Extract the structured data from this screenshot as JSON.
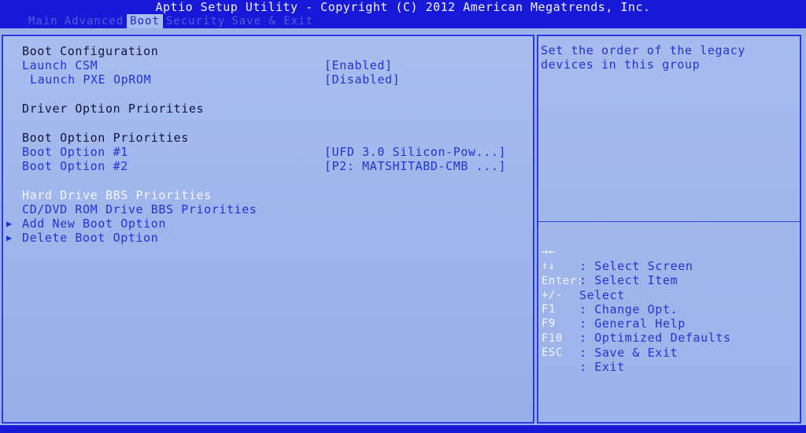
{
  "header": {
    "title": "Aptio Setup Utility - Copyright (C) 2012 American Megatrends, Inc.",
    "tabs": [
      {
        "label": "Main",
        "active": false
      },
      {
        "label": "Advanced",
        "active": false
      },
      {
        "label": "Boot",
        "active": true
      },
      {
        "label": "Security",
        "active": false
      },
      {
        "label": "Save & Exit",
        "active": false
      }
    ]
  },
  "boot": {
    "section_boot_config": "Boot Configuration",
    "launch_csm": {
      "label": "Launch CSM",
      "value": "[Enabled]"
    },
    "launch_pxe": {
      "label": "Launch PXE OpROM",
      "value": "[Disabled]"
    },
    "section_driver": "Driver Option Priorities",
    "section_boot_option": "Boot Option Priorities",
    "boot_option_1": {
      "label": "Boot Option #1",
      "value": "[UFD 3.0 Silicon-Pow...]"
    },
    "boot_option_2": {
      "label": "Boot Option #2",
      "value": "[P2: MATSHITABD-CMB ...]"
    },
    "hdd_bbs": "Hard Drive BBS Priorities",
    "cd_bbs": "CD/DVD ROM Drive BBS Priorities",
    "add_boot": "Add New Boot Option",
    "delete_boot": "Delete Boot Option",
    "submenu_arrow": "▶"
  },
  "help": {
    "line1": "Set the order of the legacy",
    "line2": "devices in this group"
  },
  "keys": [
    {
      "key": "→←",
      "desc": ": Select Screen"
    },
    {
      "key": "↑↓",
      "desc": ": Select Item"
    },
    {
      "key": "Enter:",
      "desc": "Select"
    },
    {
      "key": "+/-",
      "desc": ": Change Opt."
    },
    {
      "key": "F1",
      "desc": ": General Help"
    },
    {
      "key": "F9",
      "desc": ": Optimized Defaults"
    },
    {
      "key": "F10",
      "desc": ": Save & Exit"
    },
    {
      "key": "ESC",
      "desc": ": Exit"
    }
  ],
  "colors": {
    "header_bg": "#1818d8",
    "panel_bg": "#9bb1ea",
    "accent_blue": "#2233d8",
    "highlight_white": "#f4f6ff"
  }
}
